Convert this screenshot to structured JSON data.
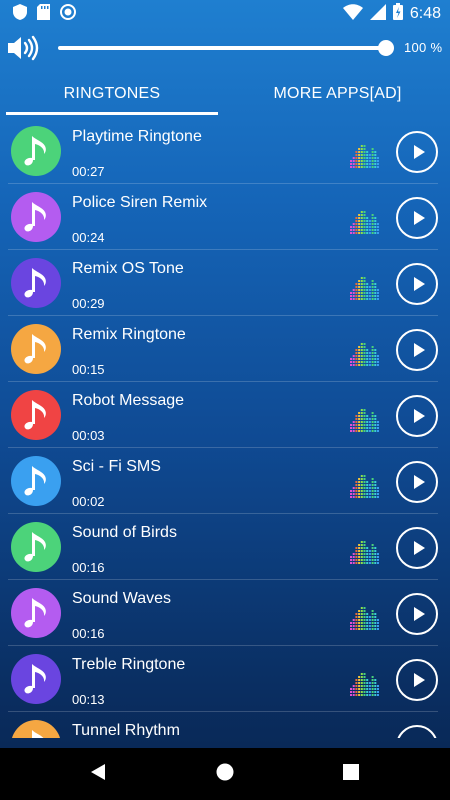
{
  "status": {
    "time": "6:48"
  },
  "volume": {
    "percent_label": "100 %",
    "level": 1.0
  },
  "tabs": [
    {
      "label": "RINGTONES",
      "active": true
    },
    {
      "label": "MORE APPS[AD]",
      "active": false
    }
  ],
  "ringtones": [
    {
      "title": "Playtime Ringtone",
      "duration": "00:27",
      "color": "#4cd37a"
    },
    {
      "title": "Police Siren Remix",
      "duration": "00:24",
      "color": "#b45cf0"
    },
    {
      "title": "Remix OS Tone",
      "duration": "00:29",
      "color": "#6a45e0"
    },
    {
      "title": "Remix Ringtone",
      "duration": "00:15",
      "color": "#f5a742"
    },
    {
      "title": "Robot Message",
      "duration": "00:03",
      "color": "#f04444"
    },
    {
      "title": "Sci - Fi SMS",
      "duration": "00:02",
      "color": "#3aa0f0"
    },
    {
      "title": "Sound of Birds",
      "duration": "00:16",
      "color": "#4cd37a"
    },
    {
      "title": "Sound Waves",
      "duration": "00:16",
      "color": "#b45cf0"
    },
    {
      "title": "Treble Ringtone",
      "duration": "00:13",
      "color": "#6a45e0"
    },
    {
      "title": "Tunnel Rhythm",
      "duration": "",
      "color": "#f5a742"
    }
  ],
  "icons": {
    "music_note": "music-note-icon",
    "play": "play-icon",
    "equalizer": "equalizer-icon",
    "volume": "volume-icon"
  }
}
